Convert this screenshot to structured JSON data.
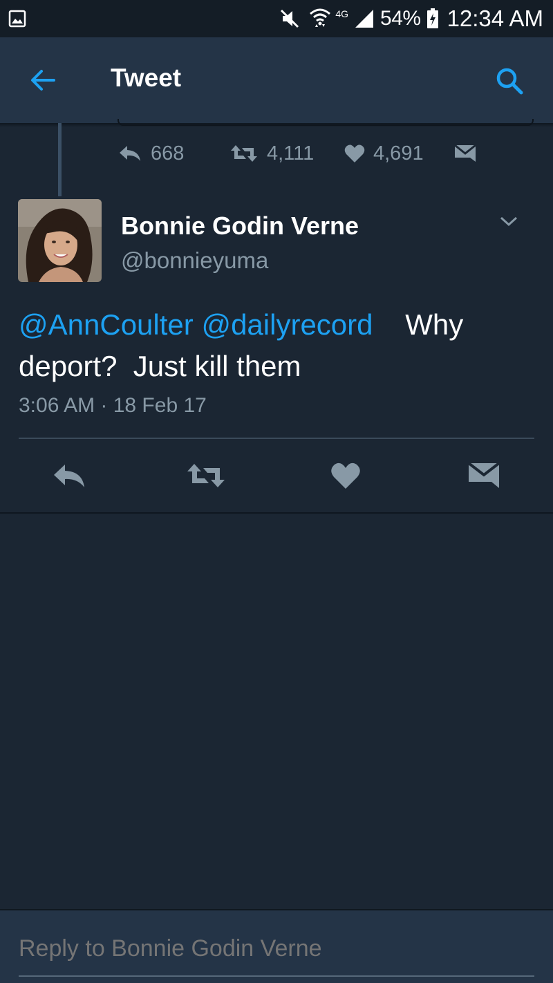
{
  "status_bar": {
    "battery": "54%",
    "time": "12:34 AM",
    "network": "4G"
  },
  "app_bar": {
    "title": "Tweet"
  },
  "previous_tweet": {
    "replies": "668",
    "retweets": "4,111",
    "likes": "4,691"
  },
  "tweet": {
    "display_name": "Bonnie Godin Verne",
    "handle": "@bonnieyuma",
    "mention_1": "@AnnCoulter",
    "mention_2": "@dailyrecord",
    "text_line_1_rest": "Why",
    "text_line_2": "deport?  Just kill them",
    "timestamp": "3:06 AM · 18 Feb 17"
  },
  "composer": {
    "placeholder": "Reply to Bonnie Godin Verne"
  },
  "colors": {
    "background": "#1b2633",
    "app_bar": "#243447",
    "accent": "#1da1f2",
    "secondary_text": "#8899a6",
    "icon_gray": "#8899a6"
  },
  "icons": {
    "status_left": "gallery-icon",
    "mute": "mute-icon",
    "wifi": "wifi-icon",
    "signal": "signal-icon",
    "battery": "battery-charging-icon",
    "back": "arrow-left-icon",
    "search": "search-icon",
    "caret": "chevron-down-icon",
    "reply": "reply-icon",
    "retweet": "retweet-icon",
    "like": "heart-icon",
    "dm": "envelope-icon"
  }
}
